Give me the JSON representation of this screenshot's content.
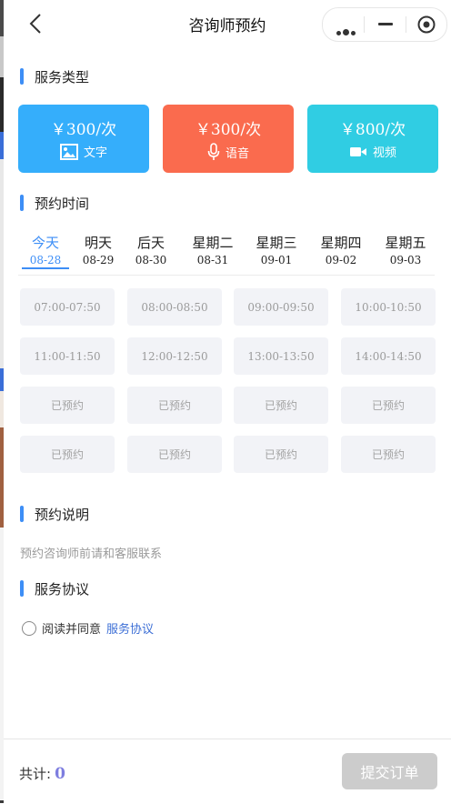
{
  "nav": {
    "title": "咨询师预约"
  },
  "sections": {
    "service_type": "服务类型",
    "appointment_time": "预约时间",
    "appointment_note": "预约说明",
    "service_agreement": "服务协议"
  },
  "services": [
    {
      "price": "￥300/次",
      "label": "文字",
      "icon": "image-icon",
      "color": "#35aefb"
    },
    {
      "price": "￥300/次",
      "label": "语音",
      "icon": "microphone-icon",
      "color": "#fa6b4e"
    },
    {
      "price": "￥800/次",
      "label": "视频",
      "icon": "video-camera-icon",
      "color": "#30cde3"
    }
  ],
  "days": [
    {
      "name": "今天",
      "date": "08-28",
      "active": true
    },
    {
      "name": "明天",
      "date": "08-29"
    },
    {
      "name": "后天",
      "date": "08-30"
    },
    {
      "name": "星期二",
      "date": "08-31"
    },
    {
      "name": "星期三",
      "date": "09-01"
    },
    {
      "name": "星期四",
      "date": "09-02"
    },
    {
      "name": "星期五",
      "date": "09-03"
    }
  ],
  "slots": [
    "07:00-07:50",
    "08:00-08:50",
    "09:00-09:50",
    "10:00-10:50",
    "11:00-11:50",
    "12:00-12:50",
    "13:00-13:50",
    "14:00-14:50",
    "已预约",
    "已预约",
    "已预约",
    "已预约",
    "已预约",
    "已预约",
    "已预约",
    "已预约"
  ],
  "note": "预约咨询师前请和客服联系",
  "agreement": {
    "text": "阅读并同意",
    "link": "服务协议"
  },
  "footer": {
    "total_label": "共计:",
    "total_value": "0",
    "submit_label": "提交订单"
  },
  "colors": {
    "accent": "#3d8ef6",
    "slot_bg": "#f2f3f7",
    "disabled": "#cccccc"
  }
}
